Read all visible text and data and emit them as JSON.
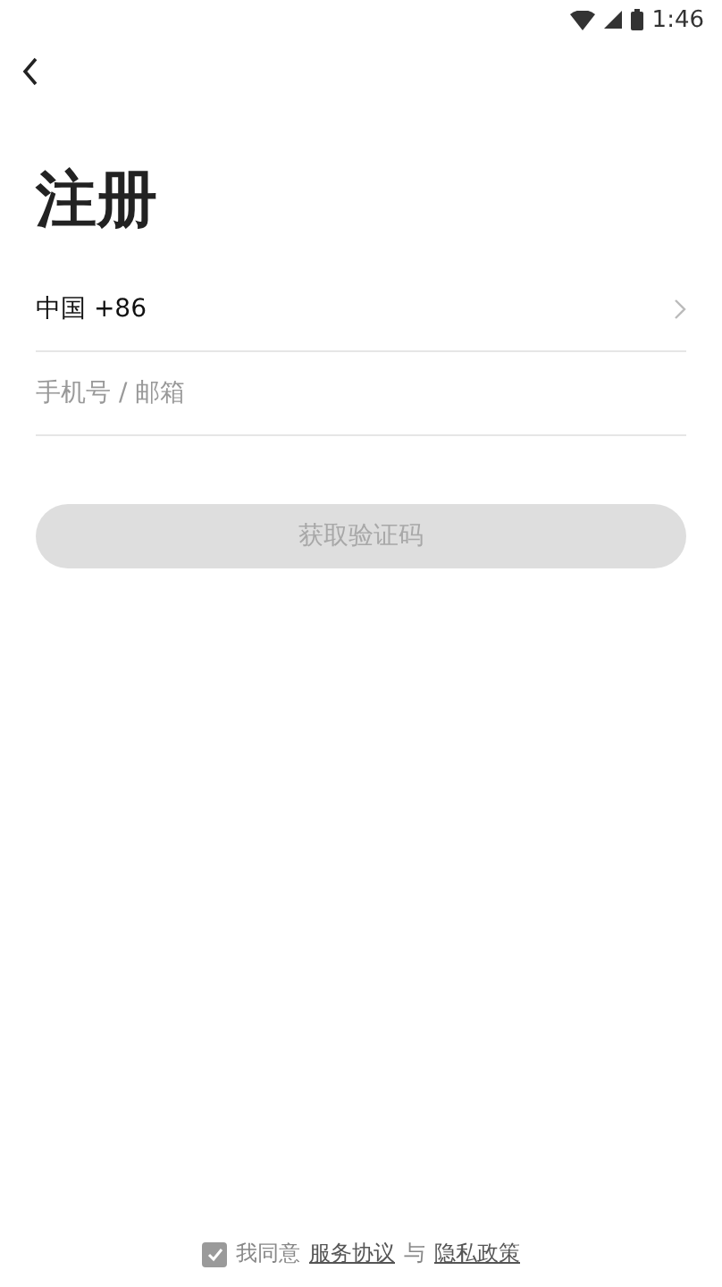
{
  "status_bar": {
    "time": "1:46"
  },
  "title": "注册",
  "country": {
    "label": "中国 +86"
  },
  "phone": {
    "placeholder": "手机号 / 邮箱"
  },
  "submit": {
    "label": "获取验证码",
    "disabled": true
  },
  "agreement": {
    "checked": true,
    "prefix": "我同意",
    "terms": "服务协议",
    "joiner": "与",
    "privacy": "隐私政策"
  }
}
